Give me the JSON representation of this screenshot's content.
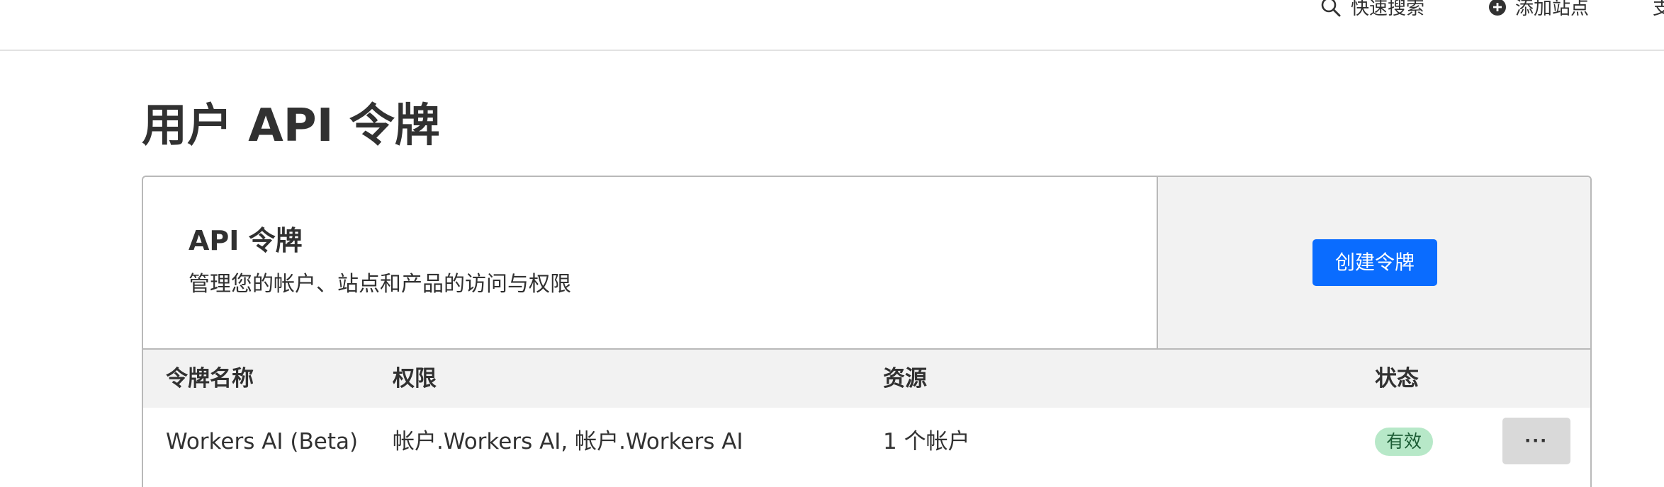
{
  "topbar": {
    "search_label": "快速搜索",
    "search_icon": "search-icon",
    "add_site_label": "添加站点",
    "add_site_icon": "plus-circle-icon",
    "cut_label": "支"
  },
  "page": {
    "title": "用户 API 令牌"
  },
  "card": {
    "title": "API 令牌",
    "description": "管理您的帐户、站点和产品的访问与权限",
    "create_button": "创建令牌"
  },
  "table": {
    "headers": {
      "name": "令牌名称",
      "permissions": "权限",
      "resources": "资源",
      "status": "状态"
    },
    "rows": [
      {
        "name": "Workers AI (Beta)",
        "permissions": "帐户.Workers AI, 帐户.Workers AI",
        "resources": "1 个帐户",
        "status": "有效",
        "more": "···"
      }
    ]
  },
  "colors": {
    "primary": "#0a6cff",
    "status_active_bg": "#b7e8c8",
    "header_bg": "#f2f2f2"
  }
}
